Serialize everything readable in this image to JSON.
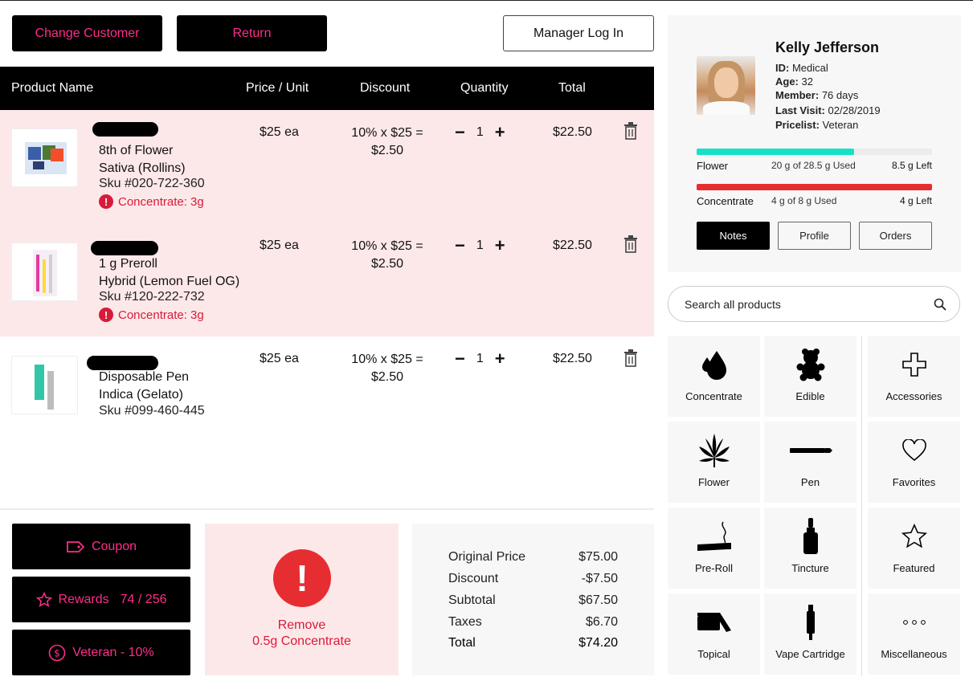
{
  "toolbar": {
    "change_customer": "Change Customer",
    "return": "Return",
    "manager_login": "Manager Log In"
  },
  "table": {
    "headers": [
      "Product Name",
      "Price / Unit",
      "Discount",
      "Quantity",
      "Total"
    ],
    "rows": [
      {
        "line1": "8th of Flower",
        "line2": "Sativa (Rollins)",
        "sku": "Sku #020-722-360",
        "warning": "Concentrate: 3g",
        "price": "$25 ea",
        "discount1": "10% x $25 =",
        "discount2": "$2.50",
        "qty": "1",
        "total": "$22.50"
      },
      {
        "line1": "1 g Preroll",
        "line2": "Hybrid (Lemon Fuel OG)",
        "sku": "Sku #120-222-732",
        "warning": "Concentrate: 3g",
        "price": "$25 ea",
        "discount1": "10% x $25 =",
        "discount2": "$2.50",
        "qty": "1",
        "total": "$22.50"
      },
      {
        "line1": "Disposable Pen",
        "line2": "Indica (Gelato)",
        "sku": "Sku #099-460-445",
        "warning": "",
        "price": "$25 ea",
        "discount1": "10% x $25 =",
        "discount2": "$2.50",
        "qty": "1",
        "total": "$22.50"
      }
    ]
  },
  "actions": {
    "coupon": "Coupon",
    "rewards": "Rewards",
    "rewards_value": "74 / 256",
    "veteran": "Veteran - 10%"
  },
  "alert": {
    "line1": "Remove",
    "line2": "0.5g Concentrate"
  },
  "summary": {
    "rows": [
      {
        "label": "Original Price",
        "value": "$75.00"
      },
      {
        "label": "Discount",
        "value": "-$7.50"
      },
      {
        "label": "Subtotal",
        "value": "$67.50"
      },
      {
        "label": "Taxes",
        "value": "$6.70"
      },
      {
        "label": "Total",
        "value": "$74.20"
      }
    ]
  },
  "customer": {
    "name": "Kelly Jefferson",
    "id_label": "ID:",
    "id": "Medical",
    "age_label": "Age:",
    "age": "32",
    "member_label": "Member:",
    "member": "76 days",
    "last_visit_label": "Last Visit:",
    "last_visit": "02/28/2019",
    "pricelist_label": "Pricelist:",
    "pricelist": "Veteran"
  },
  "limits": [
    {
      "name": "Flower",
      "used": "20 g of 28.5 g Used",
      "left": "8.5 g Left",
      "fraction": 0.67,
      "color": "#18e0c8"
    },
    {
      "name": "Concentrate",
      "used": "4 g of 8 g Used",
      "left": "4 g Left",
      "fraction": 1.0,
      "color": "#e62e32"
    }
  ],
  "profile_tabs": [
    "Notes",
    "Profile",
    "Orders"
  ],
  "search": {
    "placeholder": "Search all products"
  },
  "categories": [
    {
      "label": "Concentrate",
      "icon": "drops-icon"
    },
    {
      "label": "Edible",
      "icon": "gummy-bear-icon"
    },
    {
      "label": "Accessories",
      "icon": "plus-icon"
    },
    {
      "label": "Flower",
      "icon": "leaf-icon"
    },
    {
      "label": "Pen",
      "icon": "pen-icon"
    },
    {
      "label": "Favorites",
      "icon": "heart-icon"
    },
    {
      "label": "Pre-Roll",
      "icon": "preroll-icon"
    },
    {
      "label": "Tincture",
      "icon": "tincture-icon"
    },
    {
      "label": "Featured",
      "icon": "star-icon"
    },
    {
      "label": "Topical",
      "icon": "topical-icon"
    },
    {
      "label": "Vape Cartridge",
      "icon": "vape-cartridge-icon"
    },
    {
      "label": "Miscellaneous",
      "icon": "more-icon"
    }
  ],
  "colors": {
    "accent": "#ff2d8a",
    "alert": "#e62e32",
    "row_highlight": "#fde8e9",
    "flower_bar": "#18e0c8"
  }
}
